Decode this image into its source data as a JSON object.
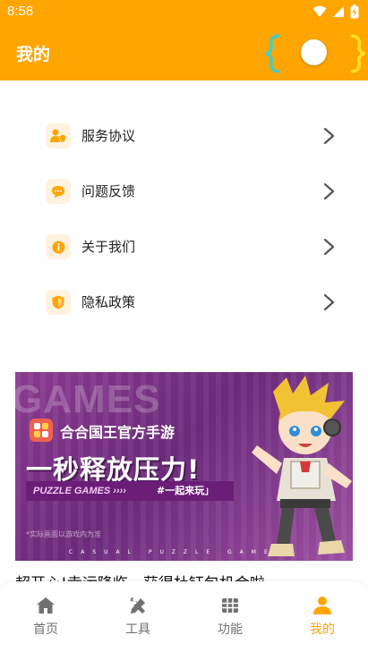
{
  "status_bar": {
    "time": "8:58"
  },
  "header": {
    "title": "我的"
  },
  "menu": {
    "items": [
      {
        "label": "服务协议",
        "icon": "user-shield-icon"
      },
      {
        "label": "问题反馈",
        "icon": "chat-icon"
      },
      {
        "label": "关于我们",
        "icon": "info-icon"
      },
      {
        "label": "隐私政策",
        "icon": "shield-icon"
      }
    ]
  },
  "banner": {
    "bg_text": "GAMES",
    "brand": "合合国王官方手游",
    "headline": "一秒释放压力!",
    "sub_label": "PUZZLE GAMES ››››",
    "slogan": "#一起来玩」",
    "tip": "*实际画面以游戏内为准",
    "bottom_text": "CASUAL PUZZLE GAMES"
  },
  "caption": "超开心!幸运降临，获得杜钰包机会啦",
  "tabbar": {
    "tabs": [
      {
        "label": "首页",
        "icon": "home-icon",
        "active": false
      },
      {
        "label": "工具",
        "icon": "tools-icon",
        "active": false
      },
      {
        "label": "功能",
        "icon": "grid-icon",
        "active": false
      },
      {
        "label": "我的",
        "icon": "person-icon",
        "active": true
      }
    ]
  },
  "colors": {
    "accent": "#FFA500",
    "icon_bg": "#FFF2DE",
    "text": "#222222",
    "inactive": "#707070"
  }
}
